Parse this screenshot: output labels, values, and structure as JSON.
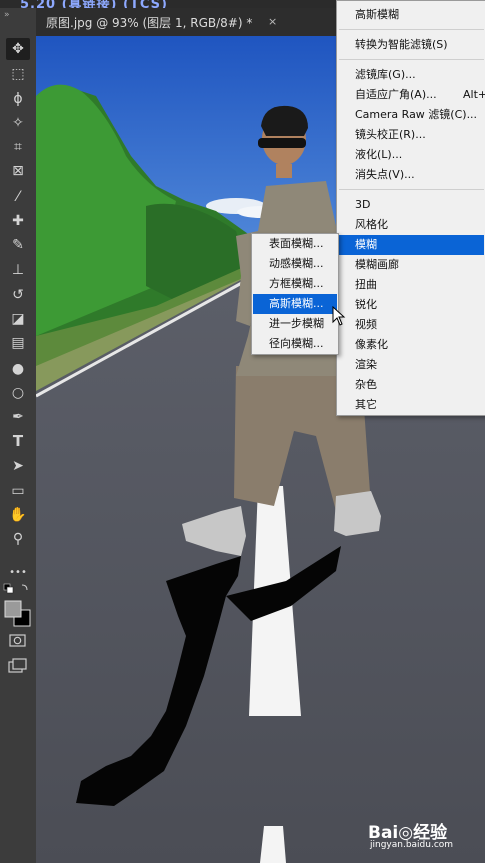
{
  "window": {
    "title_fragment": "5.20 (真链接) (TCS)"
  },
  "document_tab": {
    "label": "原图.jpg @ 93% (图层 1, RGB/8#) *",
    "close": "×"
  },
  "toolbar": {
    "expand": "»",
    "tools": [
      {
        "name": "move-tool",
        "glyph": "✥"
      },
      {
        "name": "marquee-tool",
        "glyph": "⬚"
      },
      {
        "name": "lasso-tool",
        "glyph": "ϕ"
      },
      {
        "name": "magic-wand-tool",
        "glyph": "✧"
      },
      {
        "name": "crop-tool",
        "glyph": "⌗"
      },
      {
        "name": "frame-tool",
        "glyph": "⊠"
      },
      {
        "name": "eyedropper-tool",
        "glyph": "⁄"
      },
      {
        "name": "healing-brush-tool",
        "glyph": "✚"
      },
      {
        "name": "brush-tool",
        "glyph": "✎"
      },
      {
        "name": "clone-stamp-tool",
        "glyph": "⊥"
      },
      {
        "name": "history-brush-tool",
        "glyph": "↺"
      },
      {
        "name": "eraser-tool",
        "glyph": "◪"
      },
      {
        "name": "gradient-tool",
        "glyph": "▤"
      },
      {
        "name": "blur-tool",
        "glyph": "●"
      },
      {
        "name": "dodge-tool",
        "glyph": "○"
      },
      {
        "name": "pen-tool",
        "glyph": "✒"
      },
      {
        "name": "type-tool",
        "glyph": "T"
      },
      {
        "name": "path-selection-tool",
        "glyph": "➤"
      },
      {
        "name": "rectangle-tool",
        "glyph": "▭"
      },
      {
        "name": "hand-tool",
        "glyph": "✋"
      },
      {
        "name": "zoom-tool",
        "glyph": "⚲"
      },
      {
        "name": "more-tools",
        "glyph": "•••"
      }
    ]
  },
  "filter_menu": {
    "items": [
      {
        "label": "高斯模糊",
        "shortcut": ""
      },
      {
        "label": "转换为智能滤镜(S)",
        "shortcut": ""
      },
      {
        "label": "滤镜库(G)...",
        "shortcut": ""
      },
      {
        "label": "自适应广角(A)...",
        "shortcut": "Alt+"
      },
      {
        "label": "Camera Raw 滤镜(C)...",
        "shortcut": ""
      },
      {
        "label": "镜头校正(R)...",
        "shortcut": ""
      },
      {
        "label": "液化(L)...",
        "shortcut": ""
      },
      {
        "label": "消失点(V)...",
        "shortcut": ""
      },
      {
        "label": "3D",
        "shortcut": ""
      },
      {
        "label": "风格化",
        "shortcut": ""
      },
      {
        "label": "模糊",
        "shortcut": ""
      },
      {
        "label": "模糊画廊",
        "shortcut": ""
      },
      {
        "label": "扭曲",
        "shortcut": ""
      },
      {
        "label": "锐化",
        "shortcut": ""
      },
      {
        "label": "视频",
        "shortcut": ""
      },
      {
        "label": "像素化",
        "shortcut": ""
      },
      {
        "label": "渲染",
        "shortcut": ""
      },
      {
        "label": "杂色",
        "shortcut": ""
      },
      {
        "label": "其它",
        "shortcut": ""
      }
    ]
  },
  "blur_submenu": {
    "items": [
      "表面模糊...",
      "动感模糊...",
      "方框模糊...",
      "高斯模糊...",
      "进一步模糊",
      "径向模糊..."
    ]
  },
  "watermark": {
    "brand": "Bai◎经验",
    "url": "jingyan.baidu.com"
  },
  "colors": {
    "menu_highlight": "#0a64d6",
    "sky": "#2c62c8",
    "road": "#53555e"
  }
}
